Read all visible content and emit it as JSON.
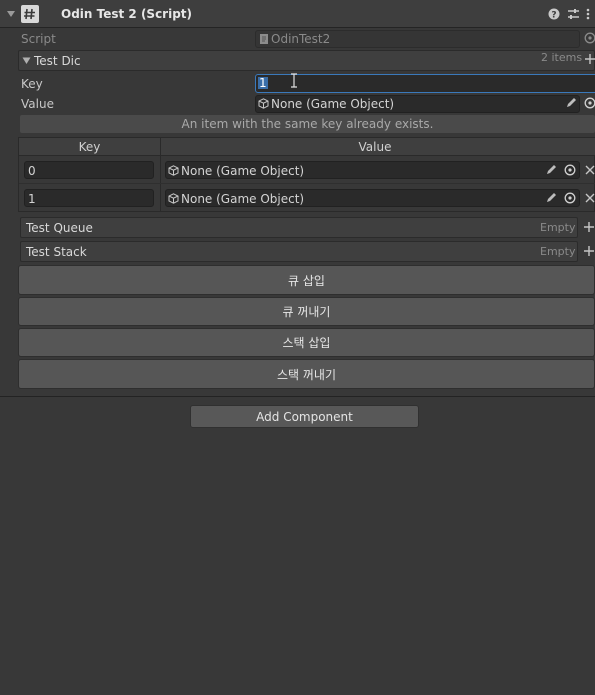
{
  "header": {
    "title": "Odin Test 2 (Script)"
  },
  "script_field": {
    "label": "Script",
    "value": "OdinTest2"
  },
  "test_dic": {
    "title": "Test Dic",
    "count": "2 items",
    "key_label": "Key",
    "key_value": "1",
    "value_label": "Value",
    "value_value": "None (Game Object)",
    "error": "An item with the same key already exists.",
    "table": {
      "col_key": "Key",
      "col_value": "Value",
      "rows": [
        {
          "key": "0",
          "value": "None (Game Object)"
        },
        {
          "key": "1",
          "value": "None (Game Object)"
        }
      ]
    }
  },
  "test_queue": {
    "title": "Test Queue",
    "status": "Empty"
  },
  "test_stack": {
    "title": "Test Stack",
    "status": "Empty"
  },
  "buttons": {
    "queue_insert": "큐 삽입",
    "queue_pop": "큐 꺼내기",
    "stack_insert": "스택 삽입",
    "stack_pop": "스택 꺼내기",
    "add_component": "Add Component"
  },
  "icons": {
    "foldout": "chevron-down-icon",
    "script": "script-hash-icon",
    "help": "help-icon",
    "presets": "presets-icon",
    "menu": "kebab-menu-icon",
    "object_picker": "object-picker-icon",
    "pencil": "pencil-icon",
    "remove": "close-icon",
    "add": "plus-icon",
    "gameobject": "cube-icon",
    "cursor": "text-cursor-icon"
  },
  "colors": {
    "background": "#383838",
    "focus_border": "#3a79bb",
    "button": "#565656"
  }
}
